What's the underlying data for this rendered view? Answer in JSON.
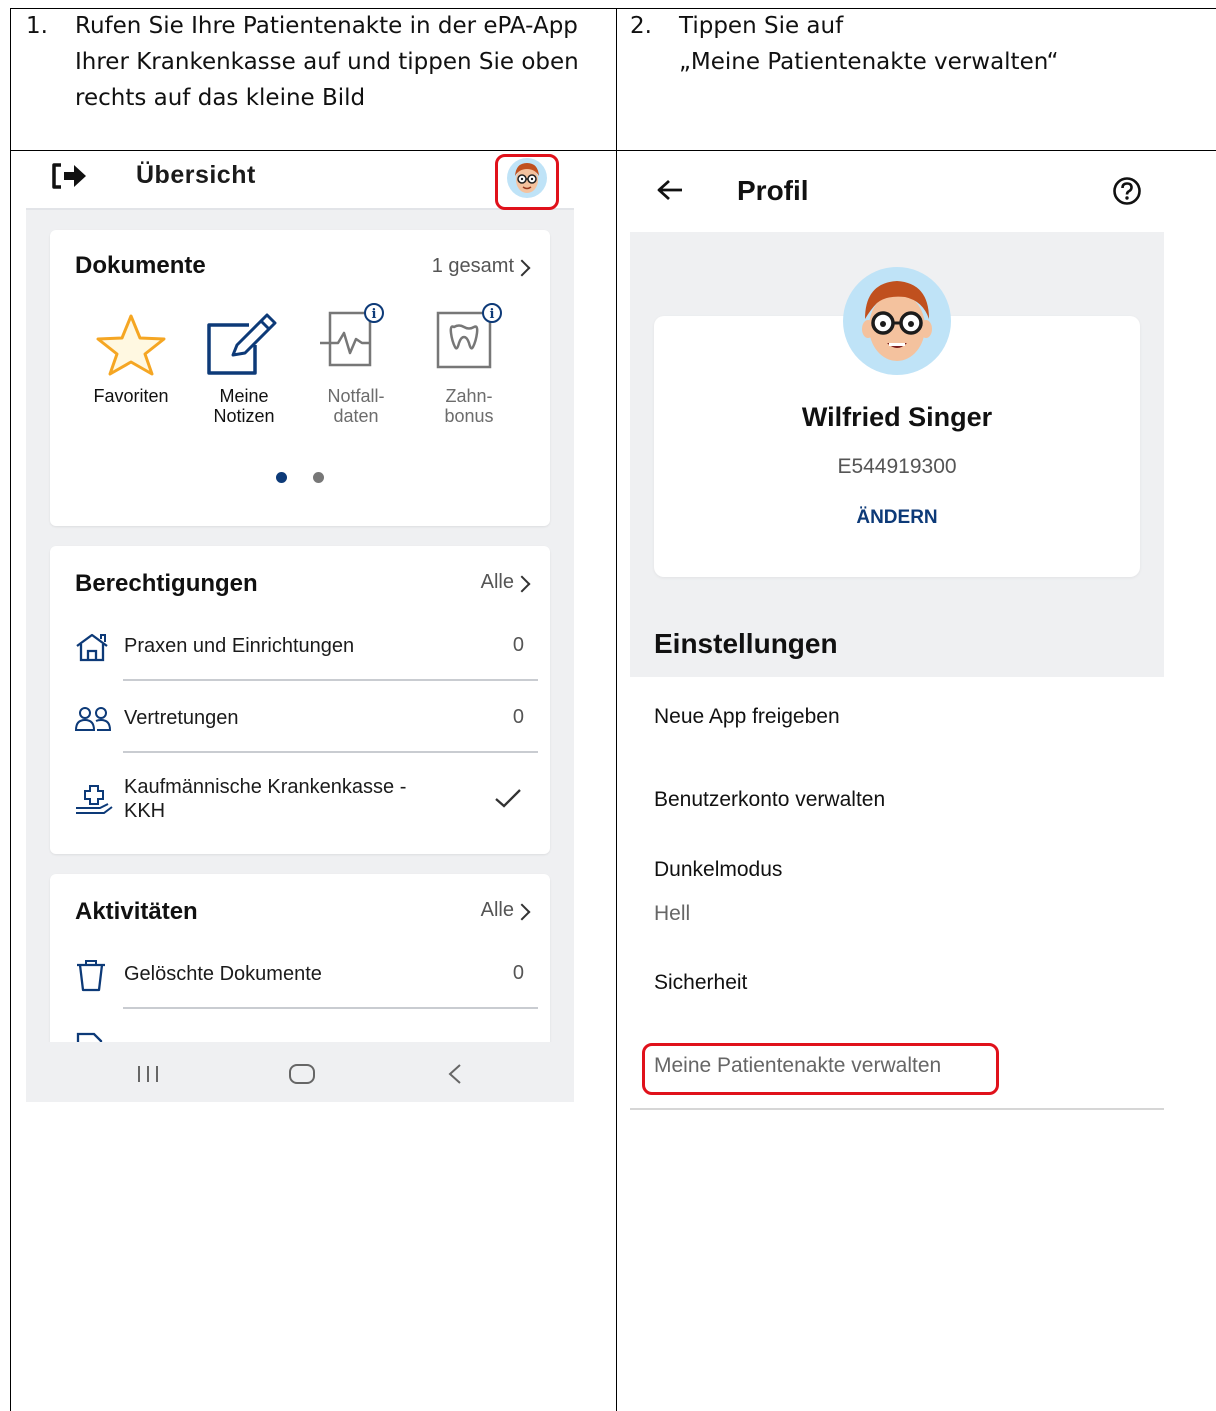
{
  "step1": {
    "number": "1.",
    "lines": [
      "Rufen Sie Ihre Patientenakte in der ePA-App",
      "Ihrer Krankenkasse auf und tippen Sie oben",
      "rechts auf das kleine Bild"
    ]
  },
  "step2": {
    "number": "2.",
    "lines": [
      "Tippen Sie auf",
      "„Meine Patientenakte verwalten“"
    ]
  },
  "overview": {
    "header": {
      "title": "Übersicht",
      "exit_icon": "exit-icon",
      "avatar_icon": "avatar-icon"
    },
    "documents": {
      "title": "Dokumente",
      "link": "1 gesamt",
      "items": [
        {
          "line1": "Favoriten",
          "line2": "",
          "icon": "star-icon"
        },
        {
          "line1": "Meine",
          "line2": "Notizen",
          "icon": "note-edit-icon"
        },
        {
          "line1": "Notfall-",
          "line2": "daten",
          "icon": "emergency-data-icon"
        },
        {
          "line1": "Zahn-",
          "line2": "bonus",
          "icon": "tooth-icon"
        }
      ],
      "pager": {
        "pages": 2,
        "active": 1
      },
      "colors": {
        "star": "#f5a623",
        "note": "#0d3a78",
        "muted": "#6c6c6c"
      }
    },
    "permissions": {
      "title": "Berechtigungen",
      "link": "Alle",
      "rows": [
        {
          "label": "Praxen und Einrichtungen",
          "count": "0",
          "icon": "home-icon"
        },
        {
          "label": "Vertretungen",
          "count": "0",
          "icon": "people-icon"
        },
        {
          "label_line1": "Kaufmännische Krankenkasse -",
          "label_line2": "KKH",
          "icon": "insurance-hand-icon",
          "status_icon": "checkmark-icon"
        }
      ]
    },
    "activities": {
      "title": "Aktivitäten",
      "link": "Alle",
      "rows": [
        {
          "label": "Gelöschte Dokumente",
          "count": "0",
          "icon": "trash-icon"
        }
      ]
    },
    "navbar": {
      "icons": [
        "recent-apps-icon",
        "home-button-icon",
        "back-icon"
      ]
    }
  },
  "profile": {
    "header": {
      "title": "Profil",
      "back_icon": "back-arrow-icon",
      "help_icon": "help-icon"
    },
    "name": "Wilfried Singer",
    "insurance_id": "E544919300",
    "change_label": "ÄNDERN",
    "section": "Einstellungen",
    "menu": {
      "new_app": "Neue App freigeben",
      "account": "Benutzerkonto verwalten",
      "dark_mode": "Dunkelmodus",
      "dark_mode_value": "Hell",
      "security": "Sicherheit",
      "manage_record": "Meine Patientenakte verwalten"
    },
    "colors": {
      "accent": "#0d3a78",
      "highlight": "#e0111b",
      "avatar_bg": "#bfe3f7"
    }
  }
}
